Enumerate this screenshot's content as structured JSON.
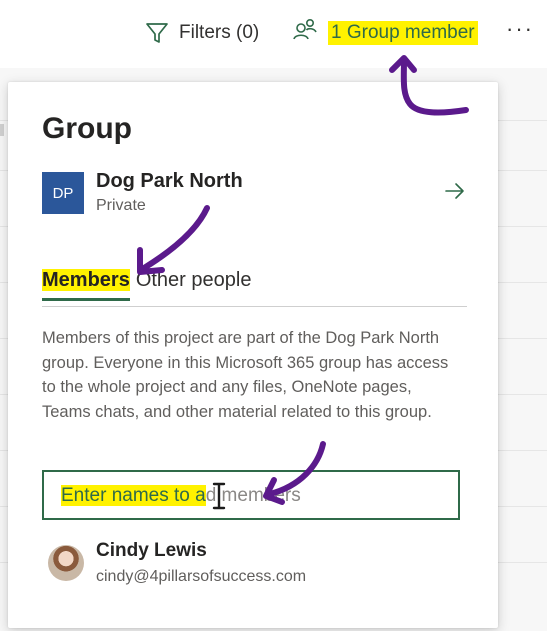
{
  "toolbar": {
    "filters_label": "Filters (0)",
    "group_member_label": "1 Group member",
    "more_label": "···"
  },
  "panel": {
    "title": "Group",
    "group": {
      "avatar_initials": "DP",
      "name": "Dog Park North",
      "privacy": "Private"
    },
    "tabs": [
      {
        "label": "Members",
        "active": true
      },
      {
        "label": "Other people",
        "active": false
      }
    ],
    "description": "Members of this project are part of the Dog Park North group. Everyone in this Microsoft 365 group has access to the whole project and any files, OneNote pages, Teams chats, and other material related to this group.",
    "member_input": {
      "placeholder_part1": "Enter names to a",
      "placeholder_part2": "d members"
    },
    "members": [
      {
        "name": "Cindy Lewis",
        "email": "cindy@4pillarsofsuccess.com"
      }
    ]
  },
  "colors": {
    "accent_green": "#2f6a49",
    "highlight_yellow": "#fff200",
    "avatar_blue": "#2b579a",
    "annotation_purple": "#5b1a8c"
  },
  "icons": {
    "filter": "funnel-icon",
    "group_member": "people-icon",
    "more": "more-horizontal-icon",
    "navigate": "arrow-right-icon",
    "text_cursor": "i-beam-cursor-icon"
  }
}
